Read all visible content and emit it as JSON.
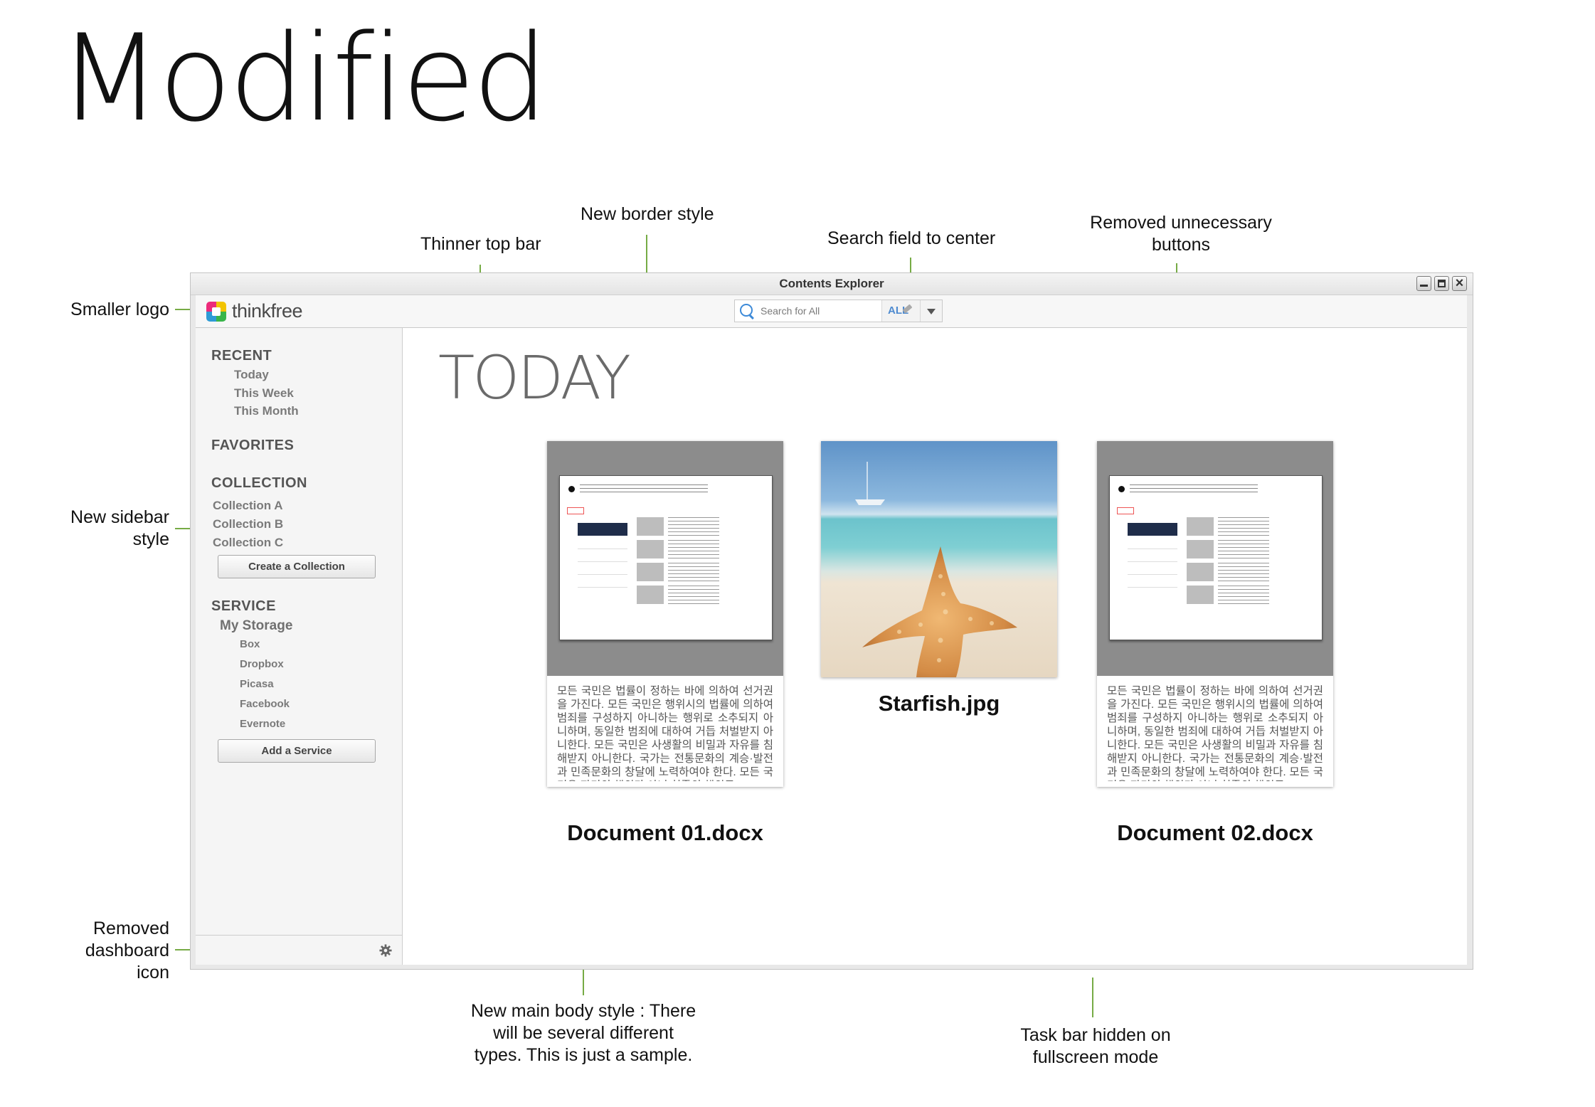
{
  "heading": "Modified",
  "annotations": {
    "smaller_logo": "Smaller logo",
    "thinner_top_bar": "Thinner top bar",
    "new_border_style": "New border style",
    "search_field_center": "Search field to center",
    "removed_buttons_1": "Removed unnecessary",
    "removed_buttons_2": "buttons",
    "new_sidebar_1": "New sidebar",
    "new_sidebar_2": "style",
    "removed_dashboard_1": "Removed",
    "removed_dashboard_2": "dashboard",
    "removed_dashboard_3": "icon",
    "main_body_1": "New main body style : There",
    "main_body_2": "will be several different",
    "main_body_3": "types. This is just a sample.",
    "taskbar_1": "Task bar hidden on",
    "taskbar_2": "fullscreen mode"
  },
  "window": {
    "title": "Contents Explorer",
    "logo_text": "thinkfree"
  },
  "search": {
    "placeholder": "Search for All",
    "scope": "ALL"
  },
  "sidebar": {
    "recent": {
      "heading": "RECENT",
      "items": [
        "Today",
        "This Week",
        "This Month"
      ]
    },
    "favorites": {
      "heading": "FAVORITES"
    },
    "collection": {
      "heading": "COLLECTION",
      "items": [
        "Collection A",
        "Collection B",
        "Collection C"
      ],
      "button": "Create a Collection"
    },
    "service": {
      "heading": "SERVICE",
      "my_storage": "My Storage",
      "items": [
        "Box",
        "Dropbox",
        "Picasa",
        "Facebook",
        "Evernote"
      ],
      "button": "Add a Service"
    }
  },
  "main": {
    "section_title": "TODAY",
    "files": [
      {
        "name": "Document 01.docx",
        "preview_text": "모든 국민은 법률이 정하는 바에 의하여 선거권을 가진다. 모든 국민은 행위시의 법률에 의하여 범죄를 구성하지 아니하는 행위로 소추되지 아니하며, 동일한 범죄에 대하여 거듭 처벌받지 아니한다. 모든 국민은 사생활의 비밀과 자유를 침해받지 아니한다. 국가는 전통문화의 계승·발전과 민족문화의 창달에 노력하여야 한다. 모든 국민은 자기의 행위가 아닌 친족의 행위로"
      },
      {
        "name": "Starfish.jpg"
      },
      {
        "name": "Document 02.docx",
        "preview_text": "모든 국민은 법률이 정하는 바에 의하여 선거권을 가진다. 모든 국민은 행위시의 법률에 의하여 범죄를 구성하지 아니하는 행위로 소추되지 아니하며, 동일한 범죄에 대하여 거듭 처벌받지 아니한다. 모든 국민은 사생활의 비밀과 자유를 침해받지 아니한다. 국가는 전통문화의 계승·발전과 민족문화의 창달에 노력하여야 한다. 모든 국민은 자기의 행위가 아닌 친족의 행위로"
      }
    ]
  },
  "colors": {
    "annotation_line": "#76ab45",
    "search_accent": "#4f8bd0"
  }
}
